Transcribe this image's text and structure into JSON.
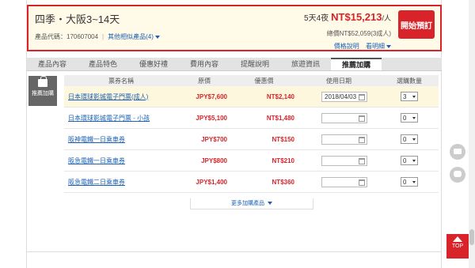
{
  "header": {
    "title": "四季・大阪3~14天",
    "product_code_label": "產品代碼：170607004",
    "similar_link": "其他相似產品(4)",
    "nights": "5天4夜",
    "price": "NT$15,213",
    "per": "/人",
    "total": "總價NT$52,059(3成人)",
    "price_info_link": "價格說明",
    "detail_link": "看明細",
    "book_button": "開始預訂"
  },
  "tabs": [
    "產品內容",
    "產品特色",
    "優惠好禮",
    "費用內容",
    "提醒說明",
    "旅遊資訊",
    "推薦加購"
  ],
  "side_tag": "推薦加購",
  "table": {
    "headers": [
      "票券名稱",
      "原價",
      "優惠價",
      "使用日期",
      "選購數量"
    ],
    "rows": [
      {
        "name": "日本環球影城電子門票(成人)",
        "orig": "JPY$7,600",
        "sale": "NT$2,140",
        "date": "2018/04/03",
        "qty": "3"
      },
      {
        "name": "日本環球影城電子門票 - 小孩",
        "orig": "JPY$5,100",
        "sale": "NT$1,480",
        "date": "",
        "qty": "0"
      },
      {
        "name": "阪神電鐵一日乘車券",
        "orig": "JPY$700",
        "sale": "NT$150",
        "date": "",
        "qty": "0"
      },
      {
        "name": "阪急電鐵一日乘車券",
        "orig": "JPY$800",
        "sale": "NT$210",
        "date": "",
        "qty": "0"
      },
      {
        "name": "阪急電鐵二日乘車券",
        "orig": "JPY$1,400",
        "sale": "NT$360",
        "date": "",
        "qty": "0"
      }
    ]
  },
  "more_button": "更多加購產品",
  "top_button": "TOP",
  "colors": {
    "accent": "#d8232a",
    "link": "#1a5fb4"
  }
}
